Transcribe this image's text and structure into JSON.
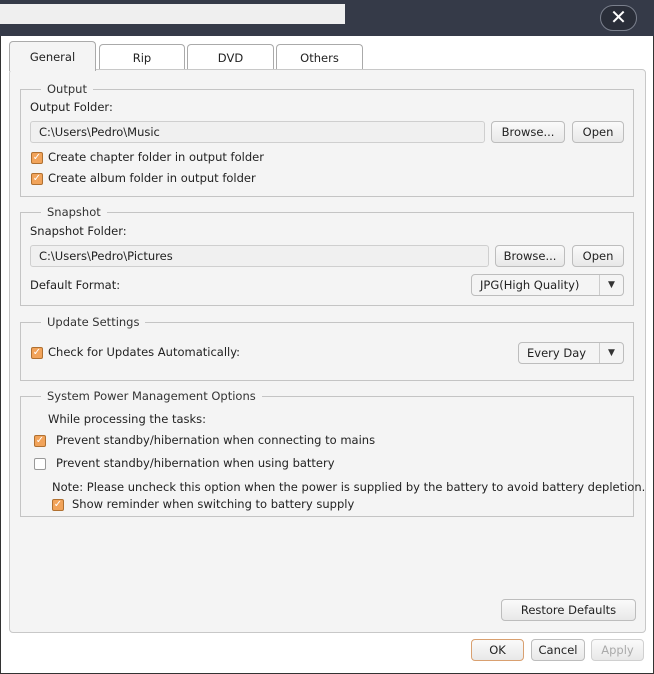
{
  "title_bar": {
    "close_icon": "close-icon"
  },
  "tabs": [
    {
      "label": "General"
    },
    {
      "label": "Rip"
    },
    {
      "label": "DVD"
    },
    {
      "label": "Others"
    }
  ],
  "output": {
    "legend": "Output",
    "folder_label": "Output Folder:",
    "folder_value": "C:\\Users\\Pedro\\Music",
    "browse": "Browse...",
    "open": "Open",
    "chapter_folder": "Create chapter folder in output folder",
    "album_folder": "Create album folder in output folder",
    "chapter_checked": true,
    "album_checked": true
  },
  "snapshot": {
    "legend": "Snapshot",
    "folder_label": "Snapshot Folder:",
    "folder_value": "C:\\Users\\Pedro\\Pictures",
    "browse": "Browse...",
    "open": "Open",
    "format_label": "Default Format:",
    "format_value": "JPG(High Quality)"
  },
  "update": {
    "legend": "Update Settings",
    "check_label": "Check for Updates Automatically:",
    "checked": true,
    "frequency": "Every Day"
  },
  "power": {
    "legend": "System Power Management Options",
    "while": "While processing the tasks:",
    "mains": "Prevent standby/hibernation when connecting to mains",
    "mains_checked": true,
    "battery": "Prevent standby/hibernation when using battery",
    "battery_checked": false,
    "note": "Note: Please uncheck this option when the power is supplied by the battery to avoid battery depletion.",
    "reminder": "Show reminder when switching to battery supply",
    "reminder_checked": true
  },
  "buttons": {
    "restore": "Restore Defaults",
    "ok": "OK",
    "cancel": "Cancel",
    "apply": "Apply"
  },
  "colors": {
    "titlebar": "#353a48",
    "checkbox": "#f1a35a"
  }
}
